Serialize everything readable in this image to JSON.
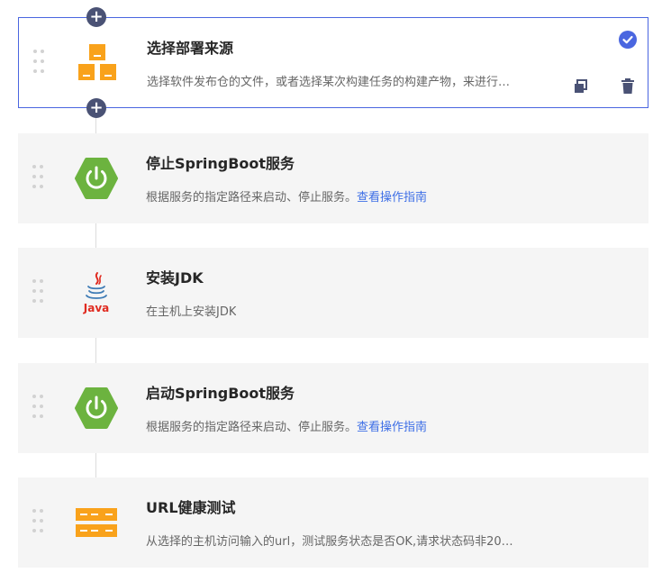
{
  "steps": [
    {
      "title": "选择部署来源",
      "desc": "选择软件发布仓的文件，或者选择某次构建任务的构建产物，来进行…",
      "link": "",
      "icon": "deploy-source-icon",
      "selected": true
    },
    {
      "title": "停止SpringBoot服务",
      "desc": "根据服务的指定路径来启动、停止服务。",
      "link": "查看操作指南",
      "icon": "springboot-power-icon"
    },
    {
      "title": "安装JDK",
      "desc": "在主机上安装JDK",
      "link": "",
      "icon": "java-icon",
      "icon_text": "Java"
    },
    {
      "title": "启动SpringBoot服务",
      "desc": "根据服务的指定路径来启动、停止服务。",
      "link": "查看操作指南",
      "icon": "springboot-power-icon"
    },
    {
      "title": "URL健康测试",
      "desc": "从选择的主机访问输入的url，测试服务状态是否OK,请求状态码非20…",
      "link": "",
      "icon": "url-health-icon"
    }
  ],
  "buttons": {
    "add_symbol": "+"
  },
  "colors": {
    "accent": "#4a66e0",
    "spring_green": "#6cb33f",
    "orange": "#f9a21b",
    "java_red": "#e02b20",
    "link": "#3d6ee6"
  }
}
